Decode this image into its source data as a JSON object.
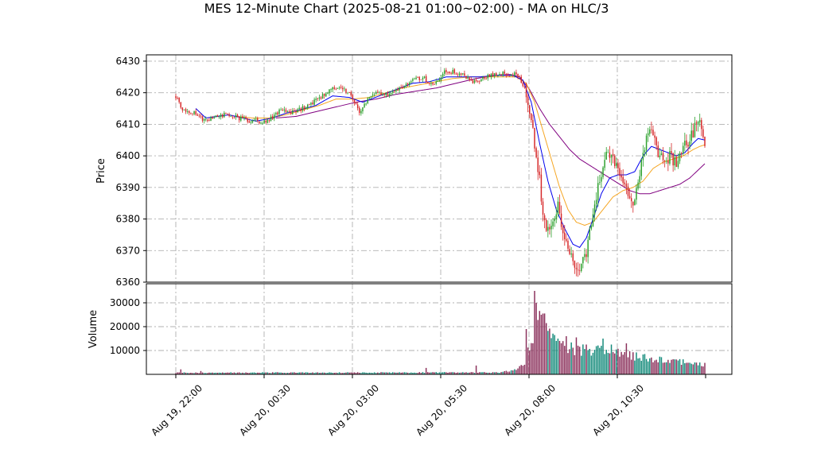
{
  "chart_data": {
    "type": "candlestick",
    "title": "MES 12-Minute Chart (2025-08-21 01:00~02:00) - MA on HLC/3",
    "price_panel": {
      "ylabel": "Price",
      "ylim": [
        6360,
        6432
      ],
      "yticks": [
        6360,
        6370,
        6380,
        6390,
        6400,
        6410,
        6420,
        6430
      ]
    },
    "volume_panel": {
      "ylabel": "Volume",
      "ylim": [
        0,
        38000
      ],
      "yticks": [
        10000,
        20000,
        30000
      ]
    },
    "x_axis": {
      "tick_labels": [
        "Aug 19, 22:00",
        "Aug 20, 00:30",
        "Aug 20, 03:00",
        "Aug 20, 05:30",
        "Aug 20, 08:00",
        "Aug 20, 10:30",
        ""
      ],
      "bar_interval_minutes": 12
    },
    "grid": true,
    "colors": {
      "up": "#2ca02c",
      "down": "#d62728",
      "vol_up": "#138a7a",
      "vol_down": "#8a2f5a",
      "ma_fast": "#0000ee",
      "ma_mid": "#f5a623",
      "ma_slow": "#800080"
    },
    "close_path": [
      [
        0,
        6419
      ],
      [
        5,
        6414
      ],
      [
        10,
        6414
      ],
      [
        18,
        6411
      ],
      [
        25,
        6413
      ],
      [
        32,
        6413
      ],
      [
        38,
        6412
      ],
      [
        45,
        6411
      ],
      [
        55,
        6411
      ],
      [
        62,
        6414
      ],
      [
        70,
        6414
      ],
      [
        80,
        6416
      ],
      [
        90,
        6420
      ],
      [
        97,
        6422
      ],
      [
        104,
        6420
      ],
      [
        110,
        6414
      ],
      [
        118,
        6420
      ],
      [
        128,
        6419
      ],
      [
        138,
        6423
      ],
      [
        148,
        6425
      ],
      [
        154,
        6422
      ],
      [
        162,
        6427
      ],
      [
        172,
        6426
      ],
      [
        178,
        6423
      ],
      [
        186,
        6425
      ],
      [
        194,
        6426
      ],
      [
        202,
        6426
      ],
      [
        206,
        6425
      ],
      [
        210,
        6420
      ],
      [
        214,
        6408
      ],
      [
        218,
        6392
      ],
      [
        221,
        6378
      ],
      [
        226,
        6378
      ],
      [
        229,
        6385
      ],
      [
        233,
        6374
      ],
      [
        237,
        6368
      ],
      [
        241,
        6365
      ],
      [
        246,
        6368
      ],
      [
        250,
        6382
      ],
      [
        254,
        6392
      ],
      [
        258,
        6400
      ],
      [
        262,
        6398
      ],
      [
        266,
        6395
      ],
      [
        270,
        6390
      ],
      [
        274,
        6384
      ],
      [
        278,
        6395
      ],
      [
        282,
        6405
      ],
      [
        285,
        6407
      ],
      [
        288,
        6402
      ],
      [
        292,
        6398
      ],
      [
        296,
        6400
      ],
      [
        300,
        6397
      ],
      [
        304,
        6403
      ],
      [
        308,
        6405
      ],
      [
        312,
        6410
      ],
      [
        314,
        6411
      ],
      [
        317,
        6405
      ]
    ],
    "ma_fast": [
      [
        12,
        6415
      ],
      [
        18,
        6412
      ],
      [
        25,
        6412.5
      ],
      [
        32,
        6413
      ],
      [
        40,
        6412
      ],
      [
        48,
        6411
      ],
      [
        58,
        6412
      ],
      [
        66,
        6413.5
      ],
      [
        74,
        6414.5
      ],
      [
        84,
        6416
      ],
      [
        94,
        6419
      ],
      [
        104,
        6418.5
      ],
      [
        112,
        6417
      ],
      [
        122,
        6419
      ],
      [
        132,
        6421
      ],
      [
        142,
        6423
      ],
      [
        152,
        6423.5
      ],
      [
        162,
        6425
      ],
      [
        172,
        6425
      ],
      [
        182,
        6425
      ],
      [
        192,
        6425.5
      ],
      [
        202,
        6425.5
      ],
      [
        208,
        6424
      ],
      [
        213,
        6417
      ],
      [
        218,
        6404
      ],
      [
        223,
        6392
      ],
      [
        228,
        6383
      ],
      [
        233,
        6377
      ],
      [
        238,
        6372
      ],
      [
        242,
        6371
      ],
      [
        246,
        6374
      ],
      [
        250,
        6380
      ],
      [
        255,
        6388
      ],
      [
        260,
        6393
      ],
      [
        265,
        6394
      ],
      [
        270,
        6394
      ],
      [
        275,
        6395
      ],
      [
        280,
        6400
      ],
      [
        285,
        6403
      ],
      [
        290,
        6402
      ],
      [
        295,
        6401
      ],
      [
        300,
        6400
      ],
      [
        305,
        6401
      ],
      [
        310,
        6404
      ],
      [
        313,
        6405.5
      ],
      [
        317,
        6405
      ]
    ],
    "ma_mid": [
      [
        36,
        6412.5
      ],
      [
        46,
        6412
      ],
      [
        56,
        6412
      ],
      [
        66,
        6413
      ],
      [
        76,
        6414.5
      ],
      [
        86,
        6416
      ],
      [
        96,
        6418
      ],
      [
        106,
        6418
      ],
      [
        116,
        6418.5
      ],
      [
        126,
        6420
      ],
      [
        136,
        6421.5
      ],
      [
        146,
        6422.5
      ],
      [
        156,
        6423.5
      ],
      [
        166,
        6424.5
      ],
      [
        176,
        6425
      ],
      [
        186,
        6425
      ],
      [
        196,
        6425
      ],
      [
        204,
        6425
      ],
      [
        210,
        6423
      ],
      [
        215,
        6417
      ],
      [
        220,
        6408
      ],
      [
        225,
        6399
      ],
      [
        230,
        6390
      ],
      [
        235,
        6383
      ],
      [
        240,
        6379
      ],
      [
        245,
        6378
      ],
      [
        250,
        6379
      ],
      [
        256,
        6383
      ],
      [
        262,
        6387
      ],
      [
        268,
        6389
      ],
      [
        274,
        6390
      ],
      [
        280,
        6392
      ],
      [
        286,
        6396
      ],
      [
        292,
        6398
      ],
      [
        298,
        6399
      ],
      [
        304,
        6400
      ],
      [
        310,
        6402
      ],
      [
        314,
        6403
      ],
      [
        317,
        6403.5
      ]
    ],
    "ma_slow": [
      [
        60,
        6412
      ],
      [
        72,
        6412.5
      ],
      [
        84,
        6414
      ],
      [
        96,
        6415.5
      ],
      [
        108,
        6417
      ],
      [
        120,
        6418
      ],
      [
        132,
        6419.5
      ],
      [
        144,
        6420.5
      ],
      [
        156,
        6421.5
      ],
      [
        168,
        6423
      ],
      [
        180,
        6424.5
      ],
      [
        192,
        6425.5
      ],
      [
        200,
        6425.8
      ],
      [
        206,
        6425
      ],
      [
        212,
        6421
      ],
      [
        218,
        6415
      ],
      [
        224,
        6410
      ],
      [
        230,
        6406
      ],
      [
        236,
        6402
      ],
      [
        242,
        6399
      ],
      [
        248,
        6397
      ],
      [
        254,
        6395
      ],
      [
        260,
        6393
      ],
      [
        266,
        6391
      ],
      [
        272,
        6389
      ],
      [
        278,
        6388
      ],
      [
        284,
        6388
      ],
      [
        290,
        6389
      ],
      [
        296,
        6390
      ],
      [
        302,
        6391
      ],
      [
        308,
        6393
      ],
      [
        313,
        6395.5
      ],
      [
        317,
        6397.5
      ]
    ],
    "volume_profile": [
      [
        0,
        700
      ],
      [
        195,
        800
      ],
      [
        205,
        2200
      ],
      [
        209,
        5000
      ],
      [
        211,
        10000
      ],
      [
        214,
        16000
      ],
      [
        217,
        21000
      ],
      [
        220,
        25000
      ],
      [
        223,
        18000
      ],
      [
        226,
        14000
      ],
      [
        230,
        12000
      ],
      [
        234,
        11000
      ],
      [
        240,
        10500
      ],
      [
        246,
        10000
      ],
      [
        252,
        10000
      ],
      [
        258,
        9500
      ],
      [
        264,
        9000
      ],
      [
        270,
        8500
      ],
      [
        276,
        7500
      ],
      [
        282,
        7000
      ],
      [
        288,
        6500
      ],
      [
        294,
        6000
      ],
      [
        300,
        5500
      ],
      [
        306,
        5000
      ],
      [
        312,
        4500
      ],
      [
        317,
        4000
      ]
    ],
    "volume_spikes": [
      [
        3,
        2100
      ],
      [
        15,
        1400
      ],
      [
        150,
        2700
      ],
      [
        180,
        3700
      ],
      [
        210,
        19000
      ],
      [
        215,
        35000
      ],
      [
        216,
        30000
      ],
      [
        219,
        25000
      ],
      [
        220,
        25500
      ],
      [
        222,
        21500
      ],
      [
        227,
        16500
      ],
      [
        229,
        15000
      ],
      [
        234,
        16000
      ],
      [
        240,
        15500
      ],
      [
        246,
        12500
      ],
      [
        256,
        15000
      ],
      [
        261,
        12500
      ],
      [
        270,
        13000
      ]
    ]
  }
}
